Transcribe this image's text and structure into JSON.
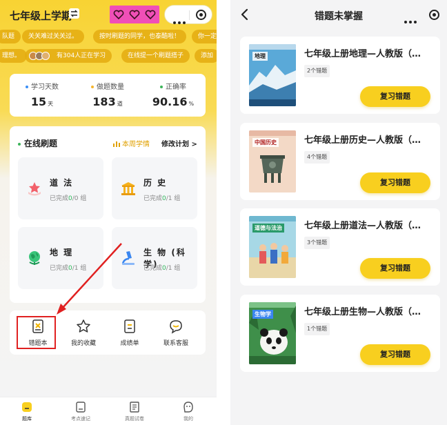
{
  "left": {
    "title": "七年级上学期",
    "marquee_row1": [
      "队题",
      "关关难过关关过。",
      "按时刷题的同学，也泰酷啦！",
      "你一定"
    ],
    "marquee_row2": [
      "理想。",
      "有304人正在学习",
      "在线提一个刷题搭子",
      "添加"
    ],
    "stats": [
      {
        "label": "学习天数",
        "value": "15",
        "unit": "天",
        "dot": "#3a8ef6"
      },
      {
        "label": "做题数量",
        "value": "183",
        "unit": "道",
        "dot": "#f6b52b"
      },
      {
        "label": "正确率",
        "value": "90.16",
        "unit": "%",
        "dot": "#3cb45a"
      }
    ],
    "online_title": "在线刷题",
    "weekly_label": "本周学情",
    "edit_plan_label": "修改计划 >",
    "subjects": [
      {
        "name": "道 法",
        "prog_prefix": "已完成",
        "done": "0",
        "total_suffix": "/0 组",
        "icon": "star-ribbon-icon"
      },
      {
        "name": "历 史",
        "prog_prefix": "已完成",
        "done": "0",
        "total_suffix": "/1 组",
        "icon": "temple-icon"
      },
      {
        "name": "地 理",
        "prog_prefix": "已完成",
        "done": "0",
        "total_suffix": "/1 组",
        "icon": "globe-icon"
      },
      {
        "name": "生 物 (科学)",
        "prog_prefix": "已完成",
        "done": "0",
        "total_suffix": "/1 组",
        "icon": "microscope-icon"
      }
    ],
    "tools": [
      {
        "label": "错题本",
        "icon": "wrong-book-icon"
      },
      {
        "label": "我的收藏",
        "icon": "star-icon"
      },
      {
        "label": "成绩单",
        "icon": "report-icon"
      },
      {
        "label": "联系客服",
        "icon": "chat-icon"
      }
    ],
    "tabs": [
      {
        "label": "题库",
        "icon": "question-bank-icon",
        "active": true
      },
      {
        "label": "考点速记",
        "icon": "notebook-icon",
        "active": false
      },
      {
        "label": "真题试卷",
        "icon": "exam-paper-icon",
        "active": false
      },
      {
        "label": "我的",
        "icon": "profile-icon",
        "active": false
      }
    ]
  },
  "right": {
    "title": "错题未掌握",
    "review_label": "复习错题",
    "books": [
      {
        "title": "七年级上册地理—人教版（…",
        "count": "2个错题",
        "cover_text": "地理",
        "cover_kind": "geography"
      },
      {
        "title": "七年级上册历史—人教版（…",
        "count": "4个错题",
        "cover_text": "中国历史",
        "cover_kind": "history"
      },
      {
        "title": "七年级上册道法—人教版（…",
        "count": "3个错题",
        "cover_text": "道德与法治",
        "cover_kind": "ethics"
      },
      {
        "title": "七年级上册生物—人教版（…",
        "count": "1个错题",
        "cover_text": "生物学",
        "cover_kind": "biology"
      }
    ]
  },
  "colors": {
    "brand_yellow": "#f8cf1f",
    "highlight_red": "#e02020",
    "progress_green": "#2fb55a",
    "pink_sticker": "#f04fb7"
  }
}
